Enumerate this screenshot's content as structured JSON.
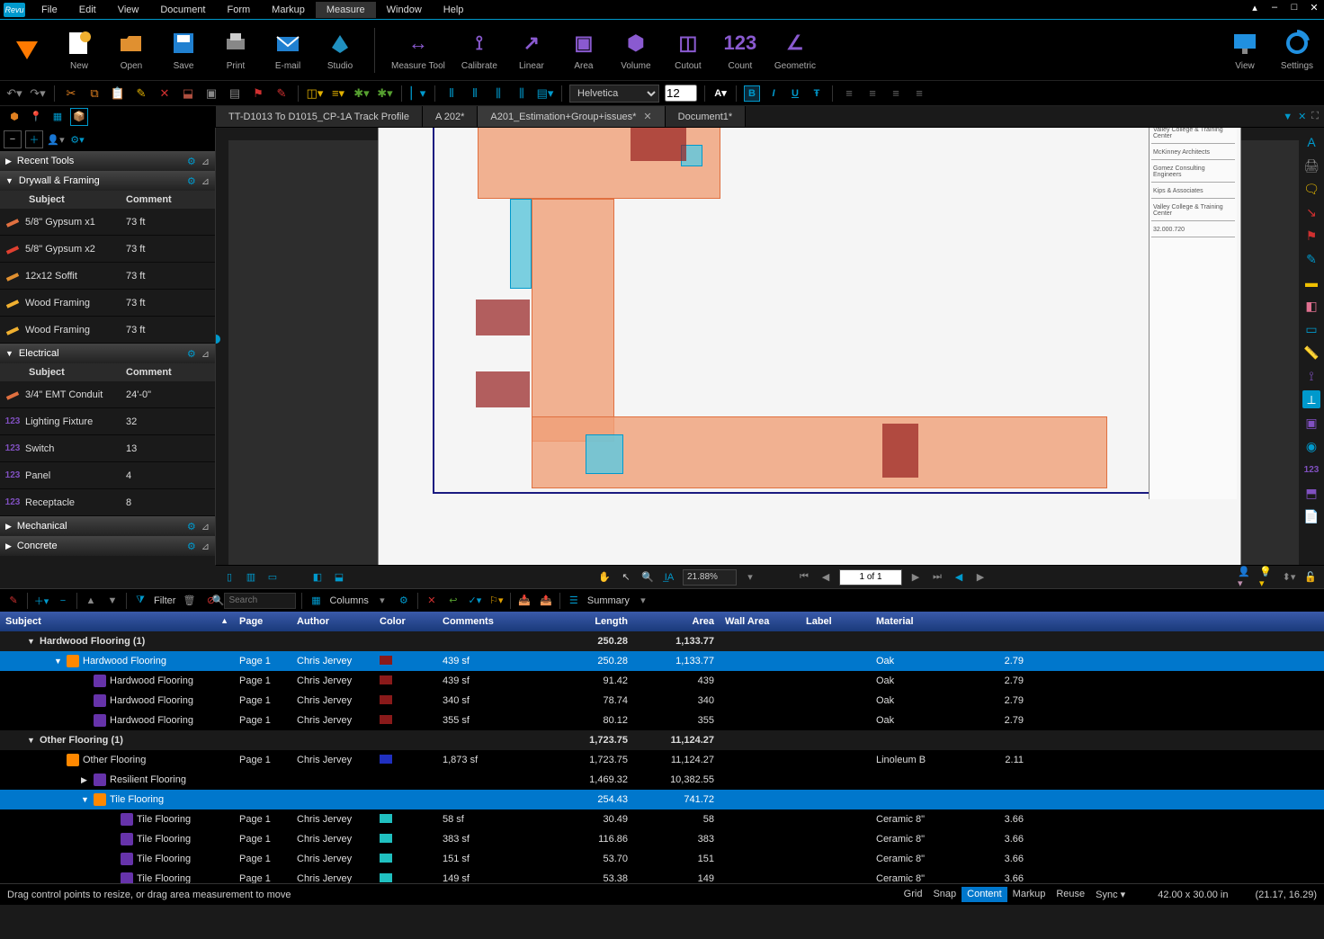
{
  "app": {
    "name": "Revu"
  },
  "menubar": [
    "File",
    "Edit",
    "View",
    "Document",
    "Form",
    "Markup",
    "Measure",
    "Window",
    "Help"
  ],
  "menubar_active": "Measure",
  "maintools": [
    {
      "id": "new",
      "label": "New",
      "color": "#f0b030"
    },
    {
      "id": "open",
      "label": "Open",
      "color": "#e09030"
    },
    {
      "id": "save",
      "label": "Save",
      "color": "#2080d0"
    },
    {
      "id": "print",
      "label": "Print",
      "color": "#888"
    },
    {
      "id": "email",
      "label": "E-mail",
      "color": "#2080d0"
    },
    {
      "id": "studio",
      "label": "Studio",
      "color": "#2090c0"
    }
  ],
  "measuretools": [
    {
      "id": "measure-tool",
      "label": "Measure Tool"
    },
    {
      "id": "calibrate",
      "label": "Calibrate"
    },
    {
      "id": "linear",
      "label": "Linear"
    },
    {
      "id": "area",
      "label": "Area"
    },
    {
      "id": "volume",
      "label": "Volume"
    },
    {
      "id": "cutout",
      "label": "Cutout"
    },
    {
      "id": "count",
      "label": "Count"
    },
    {
      "id": "geometric",
      "label": "Geometric"
    }
  ],
  "righttools": [
    {
      "id": "view",
      "label": "View"
    },
    {
      "id": "settings",
      "label": "Settings"
    }
  ],
  "font": {
    "name": "Helvetica",
    "size": "12"
  },
  "tabs": [
    {
      "label": "TT-D1013 To D1015_CP-1A Track Profile",
      "active": false
    },
    {
      "label": "A 202*",
      "active": false
    },
    {
      "label": "A201_Estimation+Group+issues*",
      "active": true
    },
    {
      "label": "Document1*",
      "active": false
    }
  ],
  "leftpanel": {
    "sections": [
      {
        "title": "Recent Tools",
        "collapsed": true
      },
      {
        "title": "Drywall & Framing",
        "collapsed": false,
        "headers": [
          "Subject",
          "Comment"
        ],
        "items": [
          {
            "subject": "5/8\" Gypsum x1",
            "comment": "73 ft",
            "color": "#e07040"
          },
          {
            "subject": "5/8\" Gypsum x2",
            "comment": "73 ft",
            "color": "#e04030"
          },
          {
            "subject": "12x12 Soffit",
            "comment": "73 ft",
            "color": "#e09030"
          },
          {
            "subject": "Wood Framing",
            "comment": "73 ft",
            "color": "#f0b030"
          },
          {
            "subject": "Wood Framing",
            "comment": "73 ft",
            "color": "#f0b030"
          }
        ]
      },
      {
        "title": "Electrical",
        "collapsed": false,
        "headers": [
          "Subject",
          "Comment"
        ],
        "items": [
          {
            "subject": "3/4\" EMT Conduit",
            "comment": "24'-0\"",
            "color": "#e07040"
          },
          {
            "subject": "Lighting Fixture",
            "comment": "32",
            "color": "#8050c0"
          },
          {
            "subject": "Switch",
            "comment": "13",
            "color": "#8050c0"
          },
          {
            "subject": "Panel",
            "comment": "4",
            "color": "#8050c0"
          },
          {
            "subject": "Receptacle",
            "comment": "8",
            "color": "#8050c0"
          }
        ]
      },
      {
        "title": "Mechanical",
        "collapsed": true
      },
      {
        "title": "Concrete",
        "collapsed": true
      }
    ]
  },
  "canvas": {
    "zoom": "21.88%",
    "page_display": "1 of 1",
    "titleblock": [
      {
        "t": "Valley College & Training Center"
      },
      {
        "t": "McKinney Architects"
      },
      {
        "t": "Gomez Consulting Engineers"
      },
      {
        "t": "Kips & Associates"
      },
      {
        "t": "Valley College & Training Center"
      },
      {
        "t": "32.000.720"
      }
    ]
  },
  "markupsbar": {
    "filter_label": "Filter",
    "search_placeholder": "Search",
    "columns_label": "Columns",
    "summary_label": "Summary"
  },
  "markups_columns": [
    "Subject",
    "Page",
    "Author",
    "Color",
    "Comments",
    "Length",
    "Area",
    "Wall Area",
    "Label",
    "Material",
    ""
  ],
  "markups_rows": [
    {
      "type": "group",
      "indent": 0,
      "subject": "Hardwood Flooring (1)",
      "length": "250.28",
      "area": "1,133.77"
    },
    {
      "type": "sel",
      "indent": 1,
      "subject": "Hardwood Flooring",
      "page": "Page 1",
      "author": "Chris Jervey",
      "color": "#8a1a1a",
      "comments": "439 sf",
      "length": "250.28",
      "area": "1,133.77",
      "material": "Oak",
      "num": "2.79",
      "ico": "#ff8800"
    },
    {
      "type": "row",
      "indent": 2,
      "subject": "Hardwood Flooring",
      "page": "Page 1",
      "author": "Chris Jervey",
      "color": "#8a1a1a",
      "comments": "439 sf",
      "length": "91.42",
      "area": "439",
      "material": "Oak",
      "num": "2.79",
      "ico": "#6633aa"
    },
    {
      "type": "row",
      "indent": 2,
      "subject": "Hardwood Flooring",
      "page": "Page 1",
      "author": "Chris Jervey",
      "color": "#8a1a1a",
      "comments": "340 sf",
      "length": "78.74",
      "area": "340",
      "material": "Oak",
      "num": "2.79",
      "ico": "#6633aa"
    },
    {
      "type": "row",
      "indent": 2,
      "subject": "Hardwood Flooring",
      "page": "Page 1",
      "author": "Chris Jervey",
      "color": "#8a1a1a",
      "comments": "355 sf",
      "length": "80.12",
      "area": "355",
      "material": "Oak",
      "num": "2.79",
      "ico": "#6633aa"
    },
    {
      "type": "group",
      "indent": 0,
      "subject": "Other Flooring (1)",
      "length": "1,723.75",
      "area": "11,124.27"
    },
    {
      "type": "row",
      "indent": 1,
      "subject": "Other Flooring",
      "page": "Page 1",
      "author": "Chris Jervey",
      "color": "#2030c0",
      "comments": "1,873 sf",
      "length": "1,723.75",
      "area": "11,124.27",
      "material": "Linoleum B",
      "num": "2.11",
      "ico": "#ff8800"
    },
    {
      "type": "row",
      "indent": 2,
      "subject": "Resilient Flooring",
      "length": "1,469.32",
      "area": "10,382.55",
      "ico": "#6633aa"
    },
    {
      "type": "sel",
      "indent": 2,
      "subject": "Tile Flooring",
      "length": "254.43",
      "area": "741.72",
      "ico": "#ff8800"
    },
    {
      "type": "row",
      "indent": 3,
      "subject": "Tile Flooring",
      "page": "Page 1",
      "author": "Chris Jervey",
      "color": "#20c0c0",
      "comments": "58 sf",
      "length": "30.49",
      "area": "58",
      "material": "Ceramic 8\"",
      "num": "3.66",
      "ico": "#6633aa"
    },
    {
      "type": "row",
      "indent": 3,
      "subject": "Tile Flooring",
      "page": "Page 1",
      "author": "Chris Jervey",
      "color": "#20c0c0",
      "comments": "383 sf",
      "length": "116.86",
      "area": "383",
      "material": "Ceramic 8\"",
      "num": "3.66",
      "ico": "#6633aa"
    },
    {
      "type": "row",
      "indent": 3,
      "subject": "Tile Flooring",
      "page": "Page 1",
      "author": "Chris Jervey",
      "color": "#20c0c0",
      "comments": "151 sf",
      "length": "53.70",
      "area": "151",
      "material": "Ceramic 8\"",
      "num": "3.66",
      "ico": "#6633aa"
    },
    {
      "type": "row",
      "indent": 3,
      "subject": "Tile Flooring",
      "page": "Page 1",
      "author": "Chris Jervey",
      "color": "#20c0c0",
      "comments": "149 sf",
      "length": "53.38",
      "area": "149",
      "material": "Ceramic 8\"",
      "num": "3.66",
      "ico": "#6633aa"
    }
  ],
  "statusbar": {
    "hint": "Drag control points to resize, or drag area measurement to move",
    "toggles": [
      "Grid",
      "Snap",
      "Content",
      "Markup",
      "Reuse",
      "Sync"
    ],
    "toggle_on": "Content",
    "dims": "42.00 x 30.00 in",
    "coords": "(21.17, 16.29)"
  }
}
